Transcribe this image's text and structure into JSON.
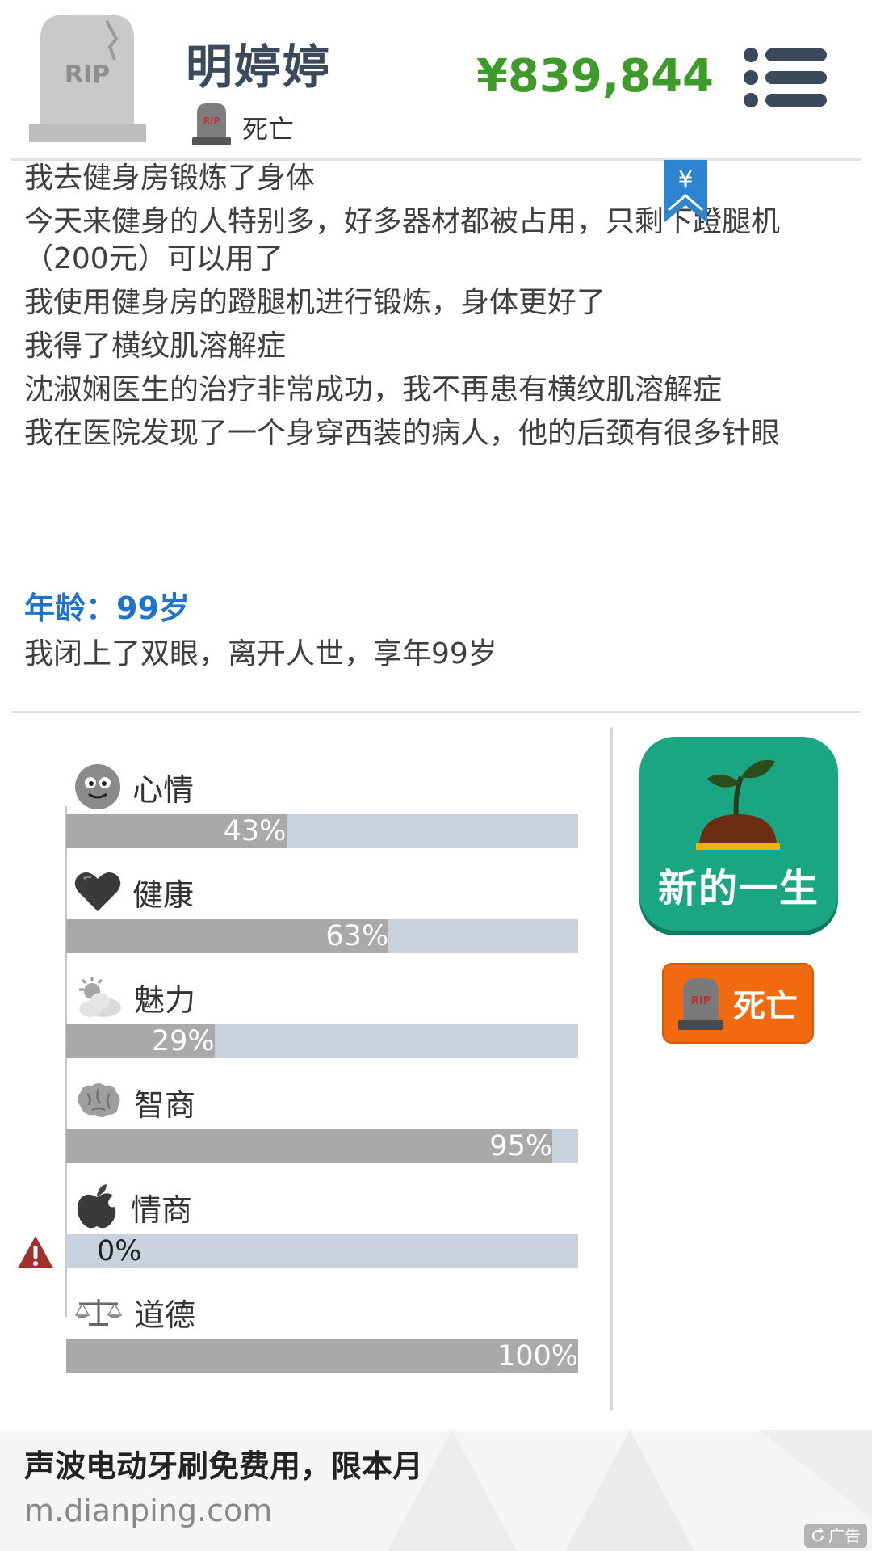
{
  "header": {
    "name": "明婷婷",
    "status": "死亡",
    "money": "¥839,844"
  },
  "bookmark": {
    "symbol": "¥"
  },
  "log": {
    "lines": [
      "我去健身房锻炼了身体",
      "今天来健身的人特别多，好多器材都被占用，只剩下蹬腿机（200元）可以用了",
      "我使用健身房的蹬腿机进行锻炼，身体更好了",
      "我得了横纹肌溶解症",
      "沈淑娴医生的治疗非常成功，我不再患有横纹肌溶解症",
      "我在医院发现了一个身穿西装的病人，他的后颈有很多针眼"
    ],
    "age": "年龄：99岁",
    "death": "我闭上了双眼，离开人世，享年99岁"
  },
  "stats": [
    {
      "label": "心情",
      "value": 43,
      "text": "43%",
      "icon": "smiley-face-icon"
    },
    {
      "label": "健康",
      "value": 63,
      "text": "63%",
      "icon": "heart-icon"
    },
    {
      "label": "魅力",
      "value": 29,
      "text": "29%",
      "icon": "sun-cloud-icon"
    },
    {
      "label": "智商",
      "value": 95,
      "text": "95%",
      "icon": "brain-icon"
    },
    {
      "label": "情商",
      "value": 0,
      "text": "0%",
      "icon": "apple-icon"
    },
    {
      "label": "道德",
      "value": 100,
      "text": "100%",
      "icon": "scales-icon"
    }
  ],
  "buttons": {
    "new_life": "新的一生",
    "death": "死亡"
  },
  "ad": {
    "title": "声波电动牙刷免费用，限本月",
    "url": "m.dianping.com",
    "badge": "广告"
  },
  "colors": {
    "money": "#3e9a2a",
    "age": "#1f74c9",
    "bar_fill": "#a9a9a9",
    "bar_track": "#c7d2de",
    "new_life_button": "#1aa682",
    "death_button": "#f26a10"
  }
}
